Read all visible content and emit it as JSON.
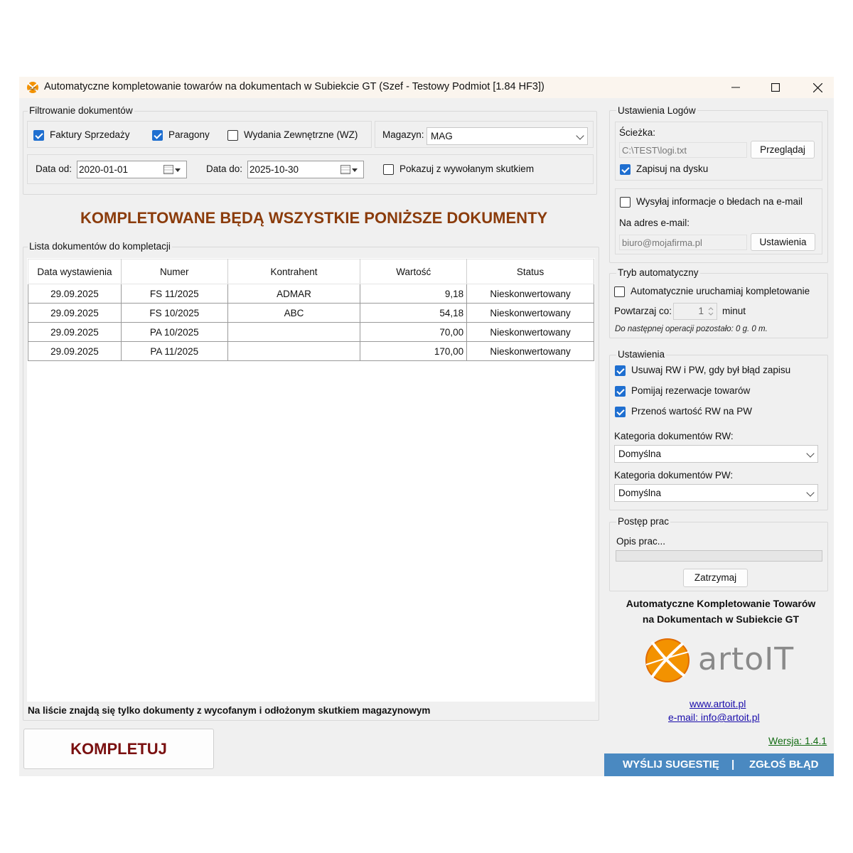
{
  "window": {
    "title": "Automatyczne kompletowanie towarów na dokumentach w Subiekcie GT (Szef - Testowy Podmiot [1.84 HF3])"
  },
  "filter": {
    "legend": "Filtrowanie dokumentów",
    "faktury_label": "Faktury Sprzedaży",
    "faktury_checked": true,
    "paragony_label": "Paragony",
    "paragony_checked": true,
    "wz_label": "Wydania Zewnętrzne (WZ)",
    "wz_checked": false,
    "magazyn_label": "Magazyn:",
    "magazyn_value": "MAG",
    "date_from_label": "Data od:",
    "date_from_value": "2020-01-01",
    "date_to_label": "Data do:",
    "date_to_value": "2025-10-30",
    "show_effect_label": "Pokazuj z wywołanym skutkiem",
    "show_effect_checked": false
  },
  "main": {
    "heading": "KOMPLETOWANE BĘDĄ WSZYSTKIE PONIŻSZE DOKUMENTY",
    "list_legend": "Lista dokumentów do kompletacji",
    "columns": [
      "Data wystawienia",
      "Numer",
      "Kontrahent",
      "Wartość",
      "Status"
    ],
    "rows": [
      {
        "date": "29.09.2025",
        "number": "FS 11/2025",
        "contractor": "ADMAR",
        "value": "9,18",
        "status": "Nieskonwertowany"
      },
      {
        "date": "29.09.2025",
        "number": "FS 10/2025",
        "contractor": "ABC",
        "value": "54,18",
        "status": "Nieskonwertowany"
      },
      {
        "date": "29.09.2025",
        "number": "PA 10/2025",
        "contractor": "",
        "value": "70,00",
        "status": "Nieskonwertowany"
      },
      {
        "date": "29.09.2025",
        "number": "PA 11/2025",
        "contractor": "",
        "value": "170,00",
        "status": "Nieskonwertowany"
      }
    ],
    "note": "Na liście znajdą się tylko dokumenty z wycofanym i odłożonym skutkiem magazynowym",
    "kompletuj_label": "KOMPLETUJ"
  },
  "logs": {
    "legend": "Ustawienia Logów",
    "path_label": "Ścieżka:",
    "path_value": "C:\\TEST\\logi.txt",
    "browse_label": "Przeglądaj",
    "save_to_disk_label": "Zapisuj na dysku",
    "save_to_disk_checked": true,
    "send_errors_label": "Wysyłaj informacje o błedach na e-mail",
    "send_errors_checked": false,
    "email_label": "Na adres e-mail:",
    "email_value": "biuro@mojafirma.pl",
    "email_settings_label": "Ustawienia"
  },
  "auto": {
    "legend": "Tryb automatyczny",
    "auto_run_label": "Automatycznie uruchamiaj kompletowanie",
    "auto_run_checked": false,
    "repeat_label": "Powtarzaj co:",
    "repeat_value": "1",
    "repeat_unit": "minut",
    "next_op": "Do następnej operacji pozostało: 0 g. 0 m."
  },
  "settings": {
    "legend": "Ustawienia",
    "opt1_label": "Usuwaj RW i PW, gdy był błąd zapisu",
    "opt1_checked": true,
    "opt2_label": "Pomijaj rezerwacje towarów",
    "opt2_checked": true,
    "opt3_label": "Przenoś wartość RW na PW",
    "opt3_checked": true,
    "rw_category_label": "Kategoria dokumentów RW:",
    "rw_category_value": "Domyślna",
    "pw_category_label": "Kategoria dokumentów PW:",
    "pw_category_value": "Domyślna"
  },
  "progress": {
    "legend": "Postęp prac",
    "description": "Opis prac...",
    "value_percent": 0,
    "stop_label": "Zatrzymaj"
  },
  "about": {
    "line1": "Automatyczne Kompletowanie Towarów",
    "line2": "na Dokumentach w Subiekcie GT",
    "logo_text": "artoIT",
    "website": "www.artoit.pl",
    "email": "e-mail: info@artoit.pl",
    "version": "Wersja: 1.4.1"
  },
  "footer": {
    "suggestion_label": "WYŚLIJ SUGESTIĘ",
    "separator": "|",
    "bug_label": "ZGŁOŚ BŁĄD"
  },
  "colors": {
    "heading": "#8b3c0c",
    "kompletuj": "#7a1010",
    "checkbox_checked": "#1f6fd0",
    "footer_bar": "#4a89c1",
    "version_link": "#126b12",
    "link": "#1a0dab",
    "logo_orange": "#f39200"
  }
}
